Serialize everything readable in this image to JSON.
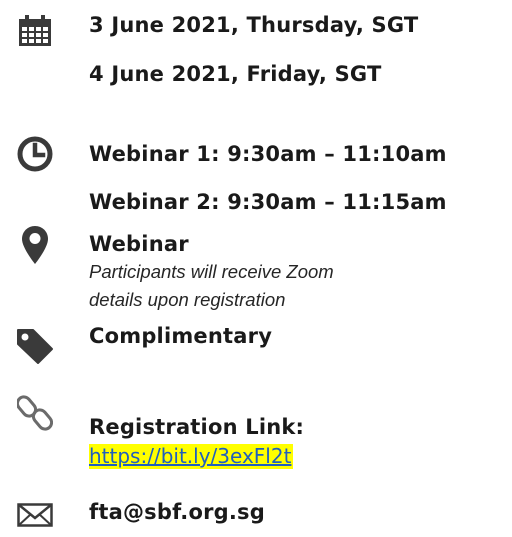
{
  "dates": {
    "icon": "calendar-icon",
    "line1": "3 June 2021, Thursday, SGT",
    "line2": "4 June 2021, Friday, SGT"
  },
  "times": {
    "icon": "clock-icon",
    "line1": "Webinar 1: 9:30am – 11:10am",
    "line2": "Webinar 2: 9:30am – 11:15am"
  },
  "venue": {
    "icon": "location-pin-icon",
    "title": "Webinar",
    "note_line1": "Participants will receive Zoom",
    "note_line2": "details upon registration"
  },
  "price": {
    "icon": "price-tag-icon",
    "label": "Complimentary"
  },
  "registration": {
    "icon": "link-icon",
    "label": "Registration Link:",
    "url_text": "https://bit.ly/3exFl2t",
    "highlight_color": "#ffff00",
    "link_color": "#1f5fbf"
  },
  "contact": {
    "icon": "envelope-icon",
    "email": "fta@sbf.org.sg"
  },
  "colors": {
    "icon": "#3a3a3a",
    "text": "#1a1a1a"
  }
}
